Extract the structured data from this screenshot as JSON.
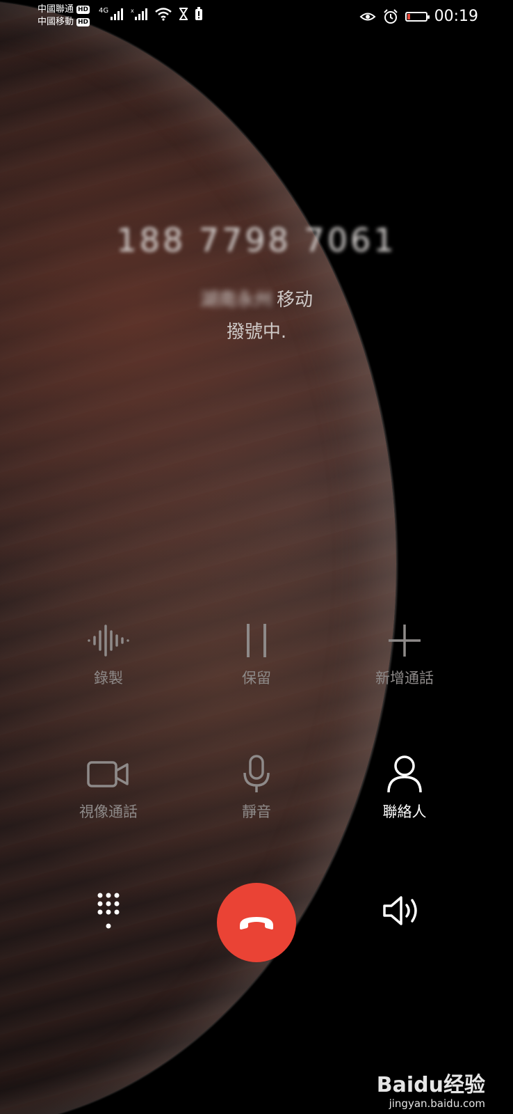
{
  "status_bar": {
    "carrier_1": "中國聯通",
    "carrier_2": "中國移動",
    "hd_badge": "HD",
    "network_type": "4G",
    "clock": "00:19"
  },
  "caller": {
    "number": "188 7798 7061",
    "location_blurred": "湖南永州",
    "location_carrier": "移动",
    "status": "撥號中."
  },
  "actions": {
    "record_label": "錄製",
    "hold_label": "保留",
    "add_call_label": "新增通話",
    "video_call_label": "視像通話",
    "mute_label": "靜音",
    "contacts_label": "聯絡人"
  },
  "watermark": {
    "brand": "Baidu经验",
    "site": "jingyan.baidu.com"
  },
  "colors": {
    "end_call": "#ea4335",
    "label_inactive": "#8e8a89",
    "label_active": "#ffffff",
    "battery_low": "#e64a3b"
  },
  "icons": [
    "eye-icon",
    "alarm-icon",
    "battery-icon",
    "signal-icon",
    "wifi-icon",
    "hourglass-icon",
    "record-waveform-icon",
    "pause-icon",
    "plus-icon",
    "video-camera-icon",
    "microphone-icon",
    "person-icon",
    "dialpad-icon",
    "hang-up-icon",
    "speaker-icon"
  ]
}
